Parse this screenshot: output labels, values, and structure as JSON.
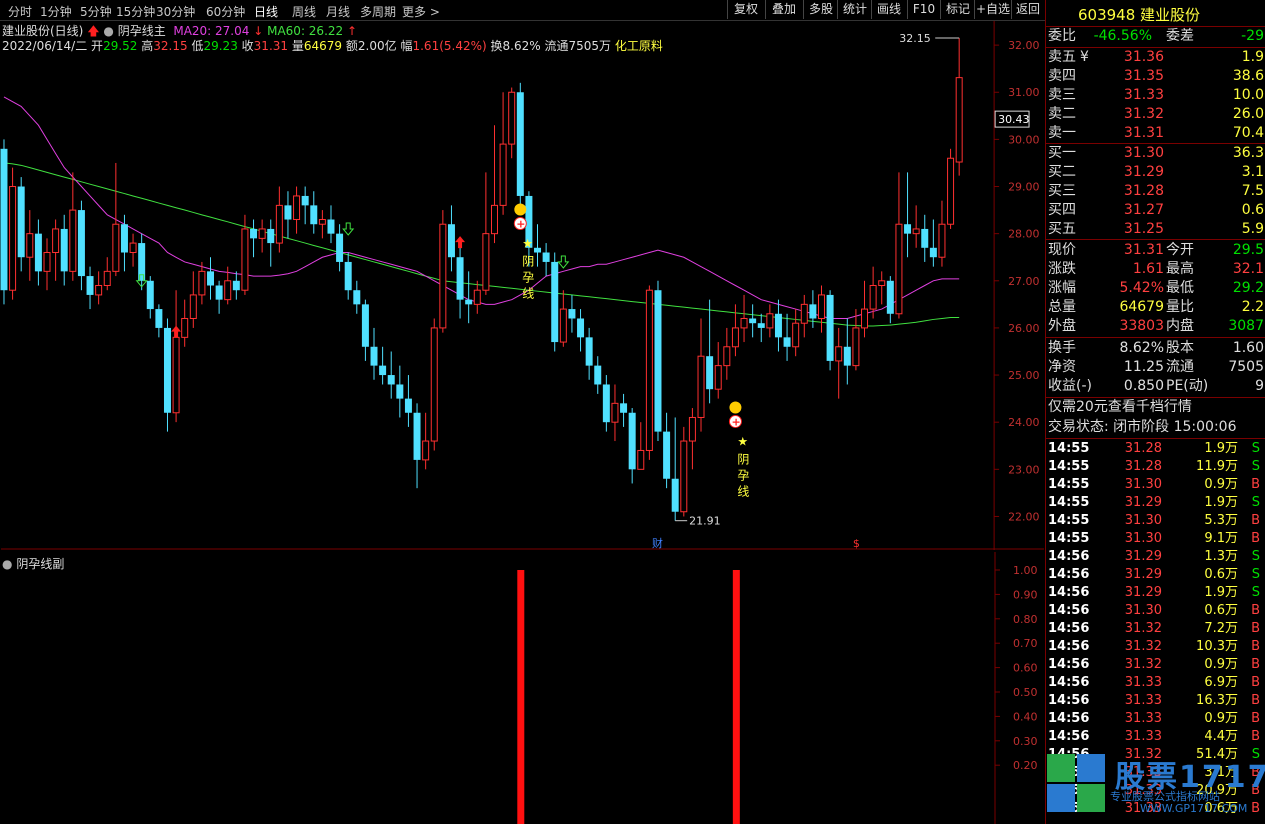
{
  "toolbar": {
    "periods": [
      "分时",
      "1分钟",
      "5分钟",
      "15分钟",
      "30分钟",
      "60分钟",
      "日线",
      "周线",
      "月线",
      "多周期",
      "更多 >"
    ],
    "active_period": "日线",
    "buttons": [
      "复权",
      "叠加",
      "多股",
      "统计",
      "画线",
      "F10",
      "标记",
      "+自选",
      "返回"
    ]
  },
  "title": {
    "stock": "建业股份(日线)",
    "indicator": "阴孕线主",
    "ma20": "MA20: 27.04",
    "ma60": "MA60: 26.22"
  },
  "info": {
    "date": "2022/06/14/二",
    "open_label": "开",
    "open": "29.52",
    "high_label": "高",
    "high": "32.15",
    "low_label": "低",
    "low": "29.23",
    "close_label": "收",
    "close": "31.31",
    "vol_label": "量",
    "vol": "64679",
    "amt_label": "额",
    "amt": "2.00亿",
    "chg_label": "幅",
    "chg": "1.61(5.42%)",
    "turn": "换8.62%",
    "float": "流通7505万",
    "industry": "化工原料"
  },
  "main_axis": [
    "32.00",
    "31.00",
    "30.00",
    "29.00",
    "28.00",
    "27.00",
    "26.00",
    "25.00",
    "24.00",
    "23.00",
    "22.00"
  ],
  "current_price_tag": "30.43",
  "high_marker": "32.15",
  "low_marker": "21.91",
  "pattern_label": "阴孕线",
  "markers": {
    "fin": "财",
    "dollar": "$"
  },
  "sub": {
    "title": "阴孕线副",
    "axis": [
      "1.00",
      "0.90",
      "0.80",
      "0.70",
      "0.60",
      "0.50",
      "0.40",
      "0.30",
      "0.20"
    ]
  },
  "panel": {
    "code": "603948",
    "name": "建业股份",
    "weibi_label": "委比",
    "weibi": "-46.56%",
    "weicha_label": "委差",
    "weicha": "-29",
    "asks": [
      {
        "label": "卖五",
        "price": "31.36",
        "vol": "1.9"
      },
      {
        "label": "卖四",
        "price": "31.35",
        "vol": "38.6"
      },
      {
        "label": "卖三",
        "price": "31.33",
        "vol": "10.0"
      },
      {
        "label": "卖二",
        "price": "31.32",
        "vol": "26.0"
      },
      {
        "label": "卖一",
        "price": "31.31",
        "vol": "70.4"
      }
    ],
    "bids": [
      {
        "label": "买一",
        "price": "31.30",
        "vol": "36.3"
      },
      {
        "label": "买二",
        "price": "31.29",
        "vol": "3.1"
      },
      {
        "label": "买三",
        "price": "31.28",
        "vol": "7.5"
      },
      {
        "label": "买四",
        "price": "31.27",
        "vol": "0.6"
      },
      {
        "label": "买五",
        "price": "31.25",
        "vol": "5.9"
      }
    ],
    "stats": [
      {
        "l1": "现价",
        "v1": "31.31",
        "c1": "red",
        "l2": "今开",
        "v2": "29.5",
        "c2": "green"
      },
      {
        "l1": "涨跌",
        "v1": "1.61",
        "c1": "red",
        "l2": "最高",
        "v2": "32.1",
        "c2": "red"
      },
      {
        "l1": "涨幅",
        "v1": "5.42%",
        "c1": "red",
        "l2": "最低",
        "v2": "29.2",
        "c2": "green"
      },
      {
        "l1": "总量",
        "v1": "64679",
        "c1": "yellow",
        "l2": "量比",
        "v2": "2.2",
        "c2": "yellow"
      },
      {
        "l1": "外盘",
        "v1": "33803",
        "c1": "red",
        "l2": "内盘",
        "v2": "3087",
        "c2": "green"
      }
    ],
    "stats2": [
      {
        "l1": "换手",
        "v1": "8.62%",
        "c1": "white",
        "l2": "股本",
        "v2": "1.60",
        "c2": "white"
      },
      {
        "l1": "净资",
        "v1": "11.25",
        "c1": "white",
        "l2": "流通",
        "v2": "7505",
        "c2": "white"
      },
      {
        "l1": "收益(-)",
        "v1": "0.850",
        "c1": "white",
        "l2": "PE(动)",
        "v2": "9",
        "c2": "white"
      }
    ],
    "promo": "仅需20元查看千档行情",
    "status": "交易状态: 闭市阶段 15:00:06",
    "ticks": [
      [
        "14:55",
        "31.28",
        "1.9万",
        "S"
      ],
      [
        "14:55",
        "31.28",
        "11.9万",
        "S"
      ],
      [
        "14:55",
        "31.30",
        "0.9万",
        "B"
      ],
      [
        "14:55",
        "31.29",
        "1.9万",
        "S"
      ],
      [
        "14:55",
        "31.30",
        "5.3万",
        "B"
      ],
      [
        "14:55",
        "31.30",
        "9.1万",
        "B"
      ],
      [
        "14:56",
        "31.29",
        "1.3万",
        "S"
      ],
      [
        "14:56",
        "31.29",
        "0.6万",
        "S"
      ],
      [
        "14:56",
        "31.29",
        "1.9万",
        "S"
      ],
      [
        "14:56",
        "31.30",
        "0.6万",
        "B"
      ],
      [
        "14:56",
        "31.32",
        "7.2万",
        "B"
      ],
      [
        "14:56",
        "31.32",
        "10.3万",
        "B"
      ],
      [
        "14:56",
        "31.32",
        "0.9万",
        "B"
      ],
      [
        "14:56",
        "31.33",
        "6.9万",
        "B"
      ],
      [
        "14:56",
        "31.33",
        "16.3万",
        "B"
      ],
      [
        "14:56",
        "31.33",
        "0.9万",
        "B"
      ],
      [
        "14:56",
        "31.33",
        "4.4万",
        "B"
      ],
      [
        "14:56",
        "31.32",
        "51.4万",
        "S"
      ],
      [
        "14:56",
        "31.33",
        "3.1万",
        "B"
      ],
      [
        "14:56",
        "31.33",
        "20.9万",
        "B"
      ],
      [
        "14:56",
        "31.33",
        "0.6万",
        "B"
      ]
    ]
  },
  "watermark": {
    "text": "股票1717",
    "sub": "专业股票公式指标网站",
    "url": "WWW.GP1717.COM"
  },
  "colors": {
    "up": "#ff3030",
    "down": "#50e0ff",
    "ma20": "#e040e0",
    "ma60": "#40e040",
    "bg": "#000000",
    "grid": "#7a0000"
  },
  "chart_data": {
    "type": "candlestick",
    "ylim": [
      21.5,
      32.3
    ],
    "ohlc": [
      [
        29.8,
        26.8,
        30.0,
        26.5
      ],
      [
        26.8,
        29.0,
        29.4,
        26.6
      ],
      [
        29.0,
        27.5,
        29.2,
        27.2
      ],
      [
        27.5,
        28.0,
        28.5,
        27.0
      ],
      [
        28.0,
        27.2,
        28.3,
        26.9
      ],
      [
        27.2,
        27.6,
        27.9,
        26.8
      ],
      [
        27.6,
        28.1,
        28.3,
        27.0
      ],
      [
        28.1,
        27.2,
        28.4,
        26.9
      ],
      [
        27.2,
        28.5,
        29.3,
        27.0
      ],
      [
        28.5,
        27.1,
        28.7,
        26.8
      ],
      [
        27.1,
        26.7,
        27.3,
        26.4
      ],
      [
        26.7,
        26.9,
        27.2,
        26.5
      ],
      [
        26.9,
        27.2,
        27.5,
        26.8
      ],
      [
        27.2,
        28.2,
        29.5,
        27.1
      ],
      [
        28.2,
        27.6,
        28.4,
        27.2
      ],
      [
        27.6,
        27.8,
        28.0,
        27.3
      ],
      [
        27.8,
        27.0,
        28.0,
        26.8
      ],
      [
        27.0,
        26.4,
        27.1,
        26.2
      ],
      [
        26.4,
        26.0,
        26.5,
        25.8
      ],
      [
        26.0,
        24.2,
        26.2,
        23.8
      ],
      [
        24.2,
        25.8,
        26.8,
        24.0
      ],
      [
        25.8,
        26.2,
        26.6,
        25.6
      ],
      [
        26.2,
        26.7,
        27.2,
        26.0
      ],
      [
        26.7,
        27.2,
        27.4,
        26.5
      ],
      [
        27.2,
        26.9,
        27.5,
        26.6
      ],
      [
        26.9,
        26.6,
        27.0,
        26.3
      ],
      [
        26.6,
        27.0,
        27.3,
        26.5
      ],
      [
        27.0,
        26.8,
        27.2,
        26.6
      ],
      [
        26.8,
        28.1,
        28.4,
        26.7
      ],
      [
        28.1,
        27.9,
        28.3,
        27.5
      ],
      [
        27.9,
        28.1,
        28.3,
        27.6
      ],
      [
        28.1,
        27.8,
        28.3,
        27.3
      ],
      [
        27.8,
        28.6,
        29.0,
        27.6
      ],
      [
        28.6,
        28.3,
        28.9,
        27.9
      ],
      [
        28.3,
        28.8,
        29.0,
        28.0
      ],
      [
        28.8,
        28.6,
        29.0,
        28.2
      ],
      [
        28.6,
        28.2,
        28.9,
        28.0
      ],
      [
        28.2,
        28.3,
        28.5,
        27.9
      ],
      [
        28.3,
        28.0,
        28.6,
        27.8
      ],
      [
        28.0,
        27.4,
        28.2,
        27.2
      ],
      [
        27.4,
        26.8,
        27.6,
        26.6
      ],
      [
        26.8,
        26.5,
        27.0,
        26.3
      ],
      [
        26.5,
        25.6,
        26.6,
        25.3
      ],
      [
        25.6,
        25.2,
        26.0,
        24.9
      ],
      [
        25.2,
        25.0,
        25.6,
        24.8
      ],
      [
        25.0,
        24.8,
        25.5,
        24.5
      ],
      [
        24.8,
        24.5,
        25.2,
        24.1
      ],
      [
        24.5,
        24.2,
        25.0,
        23.9
      ],
      [
        24.2,
        23.2,
        24.4,
        22.6
      ],
      [
        23.2,
        23.6,
        24.2,
        23.0
      ],
      [
        23.6,
        26.0,
        26.2,
        23.4
      ],
      [
        26.0,
        28.2,
        28.5,
        25.9
      ],
      [
        28.2,
        27.5,
        28.6,
        27.2
      ],
      [
        27.5,
        26.6,
        27.9,
        26.2
      ],
      [
        26.6,
        26.5,
        27.2,
        26.1
      ],
      [
        26.5,
        26.8,
        27.0,
        26.3
      ],
      [
        26.8,
        28.0,
        29.3,
        26.7
      ],
      [
        28.0,
        28.6,
        30.3,
        27.8
      ],
      [
        28.6,
        29.9,
        31.0,
        28.4
      ],
      [
        29.9,
        31.0,
        31.1,
        29.6
      ],
      [
        31.0,
        28.8,
        31.2,
        28.5
      ],
      [
        28.8,
        27.7,
        28.9,
        27.3
      ],
      [
        27.7,
        27.6,
        28.2,
        27.3
      ],
      [
        27.6,
        27.4,
        27.8,
        27.1
      ],
      [
        27.4,
        25.7,
        27.6,
        25.5
      ],
      [
        25.7,
        26.4,
        26.8,
        25.6
      ],
      [
        26.4,
        26.2,
        26.7,
        25.9
      ],
      [
        26.2,
        25.8,
        26.4,
        25.5
      ],
      [
        25.8,
        25.2,
        26.0,
        24.9
      ],
      [
        25.2,
        24.8,
        25.4,
        24.6
      ],
      [
        24.8,
        24.0,
        25.0,
        23.8
      ],
      [
        24.0,
        24.4,
        24.8,
        23.6
      ],
      [
        24.4,
        24.2,
        24.6,
        23.9
      ],
      [
        24.2,
        23.0,
        24.3,
        22.7
      ],
      [
        23.0,
        23.4,
        24.0,
        23.0
      ],
      [
        23.4,
        26.8,
        26.9,
        23.2
      ],
      [
        26.8,
        23.8,
        27.0,
        23.6
      ],
      [
        23.8,
        22.8,
        24.2,
        22.6
      ],
      [
        22.8,
        22.1,
        24.1,
        21.91
      ],
      [
        22.1,
        23.6,
        23.9,
        22.0
      ],
      [
        23.6,
        24.1,
        24.3,
        23.0
      ],
      [
        24.1,
        25.4,
        26.2,
        23.8
      ],
      [
        25.4,
        24.7,
        26.6,
        24.4
      ],
      [
        24.7,
        25.2,
        25.7,
        24.5
      ],
      [
        25.2,
        25.6,
        26.0,
        24.9
      ],
      [
        25.6,
        26.0,
        26.5,
        25.4
      ],
      [
        26.0,
        26.2,
        26.7,
        25.7
      ],
      [
        26.2,
        26.1,
        26.5,
        25.8
      ],
      [
        26.1,
        26.0,
        26.3,
        25.7
      ],
      [
        26.0,
        26.3,
        26.5,
        25.8
      ],
      [
        26.3,
        25.8,
        26.6,
        25.5
      ],
      [
        25.8,
        25.6,
        26.3,
        25.3
      ],
      [
        25.6,
        26.1,
        26.4,
        25.4
      ],
      [
        26.1,
        26.5,
        26.7,
        25.8
      ],
      [
        26.5,
        26.2,
        26.8,
        26.0
      ],
      [
        26.2,
        26.7,
        26.9,
        25.9
      ],
      [
        26.7,
        25.3,
        26.8,
        25.1
      ],
      [
        25.3,
        25.6,
        26.0,
        24.5
      ],
      [
        25.6,
        25.2,
        26.2,
        24.8
      ],
      [
        25.2,
        26.0,
        26.4,
        25.1
      ],
      [
        26.0,
        26.4,
        27.0,
        25.8
      ],
      [
        26.4,
        26.9,
        27.3,
        26.2
      ],
      [
        26.9,
        27.0,
        27.2,
        26.5
      ],
      [
        27.0,
        26.3,
        27.1,
        26.1
      ],
      [
        26.3,
        28.2,
        29.3,
        26.2
      ],
      [
        28.2,
        28.0,
        29.3,
        27.5
      ],
      [
        28.0,
        28.1,
        28.6,
        27.7
      ],
      [
        28.1,
        27.7,
        28.4,
        27.4
      ],
      [
        27.7,
        27.5,
        28.3,
        27.3
      ],
      [
        27.5,
        28.2,
        28.7,
        27.3
      ],
      [
        28.2,
        29.6,
        29.8,
        28.1
      ],
      [
        29.52,
        31.31,
        32.15,
        29.23
      ]
    ],
    "ma20": [
      30.9,
      30.8,
      30.7,
      30.5,
      30.3,
      30.0,
      29.7,
      29.4,
      29.2,
      29.0,
      28.8,
      28.6,
      28.4,
      28.3,
      28.2,
      28.1,
      28.0,
      27.9,
      27.8,
      27.6,
      27.5,
      27.4,
      27.35,
      27.3,
      27.25,
      27.2,
      27.18,
      27.15,
      27.13,
      27.1,
      27.1,
      27.1,
      27.12,
      27.15,
      27.2,
      27.3,
      27.4,
      27.5,
      27.55,
      27.6,
      27.6,
      27.55,
      27.5,
      27.45,
      27.4,
      27.35,
      27.3,
      27.25,
      27.2,
      27.1,
      27.0,
      26.9,
      26.8,
      26.7,
      26.6,
      26.55,
      26.5,
      26.5,
      26.55,
      26.6,
      26.7,
      26.8,
      26.95,
      27.1,
      27.15,
      27.2,
      27.25,
      27.3,
      27.3,
      27.35,
      27.35,
      27.4,
      27.45,
      27.5,
      27.55,
      27.6,
      27.65,
      27.6,
      27.55,
      27.5,
      27.4,
      27.3,
      27.2,
      27.1,
      27.0,
      26.9,
      26.8,
      26.7,
      26.6,
      26.55,
      26.5,
      26.45,
      26.4,
      26.35,
      26.3,
      26.25,
      26.2,
      26.2,
      26.2,
      26.25,
      26.3,
      26.35,
      26.4,
      26.5,
      26.6,
      26.7,
      26.8,
      26.9,
      27.0,
      27.04,
      27.04,
      27.04
    ],
    "ma60": [
      29.5,
      29.48,
      29.45,
      29.4,
      29.35,
      29.3,
      29.25,
      29.2,
      29.15,
      29.1,
      29.05,
      29.0,
      28.95,
      28.9,
      28.85,
      28.8,
      28.75,
      28.7,
      28.65,
      28.6,
      28.55,
      28.5,
      28.45,
      28.4,
      28.35,
      28.3,
      28.25,
      28.2,
      28.15,
      28.1,
      28.05,
      28.0,
      27.95,
      27.9,
      27.85,
      27.8,
      27.75,
      27.7,
      27.65,
      27.6,
      27.55,
      27.5,
      27.45,
      27.4,
      27.35,
      27.3,
      27.25,
      27.2,
      27.15,
      27.1,
      27.05,
      27.0,
      26.98,
      26.96,
      26.94,
      26.92,
      26.9,
      26.88,
      26.86,
      26.84,
      26.82,
      26.8,
      26.78,
      26.76,
      26.74,
      26.72,
      26.7,
      26.68,
      26.66,
      26.64,
      26.62,
      26.6,
      26.58,
      26.56,
      26.54,
      26.52,
      26.5,
      26.48,
      26.46,
      26.44,
      26.42,
      26.4,
      26.38,
      26.36,
      26.34,
      26.32,
      26.3,
      26.28,
      26.26,
      26.24,
      26.22,
      26.2,
      26.18,
      26.16,
      26.14,
      26.12,
      26.1,
      26.08,
      26.06,
      26.05,
      26.04,
      26.04,
      26.05,
      26.06,
      26.08,
      26.1,
      26.12,
      26.15,
      26.18,
      26.2,
      26.22,
      26.22
    ],
    "signal_bars": [
      {
        "index": 60,
        "value": 1.0
      },
      {
        "index": 85,
        "value": 1.0
      }
    ]
  }
}
